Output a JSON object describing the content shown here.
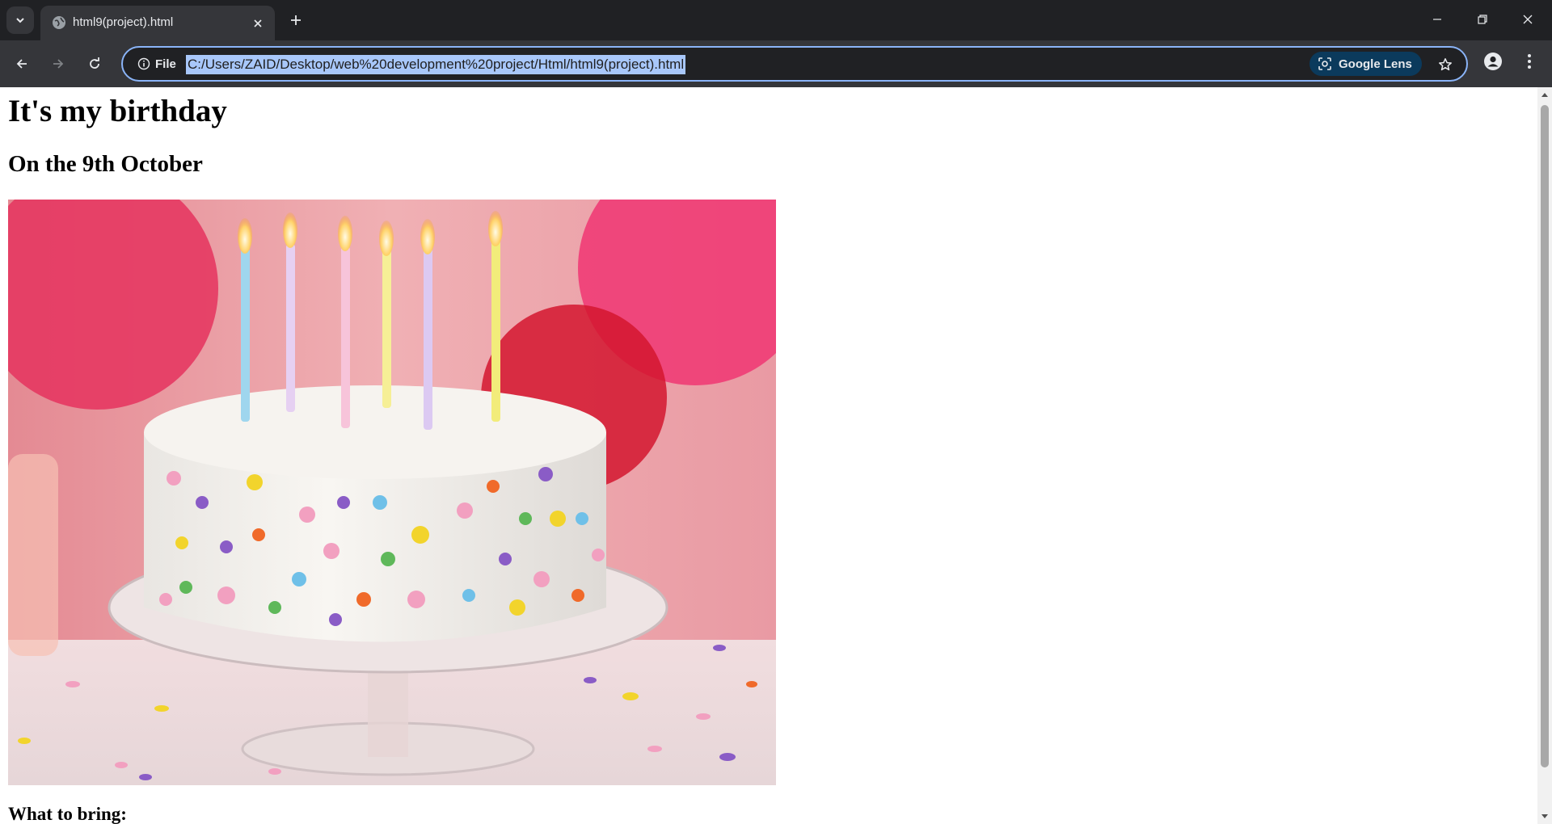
{
  "browser": {
    "tab": {
      "title": "html9(project).html"
    },
    "omnibox": {
      "site_info_label": "File",
      "url": "C:/Users/ZAID/Desktop/web%20development%20project/Html/html9(project).html",
      "lens_label": "Google Lens"
    }
  },
  "page": {
    "heading": "It's my birthday",
    "subheading": "On the 9th October",
    "image": {
      "alt": "birthday-cake-photo"
    },
    "bring_heading": "What to bring:"
  },
  "colors": {
    "chrome_bg": "#202124",
    "toolbar_bg": "#35363a",
    "url_highlight": "#a8c7fa",
    "omnibox_border": "#8ab4f8",
    "lens_chip": "#0b3a5c"
  }
}
